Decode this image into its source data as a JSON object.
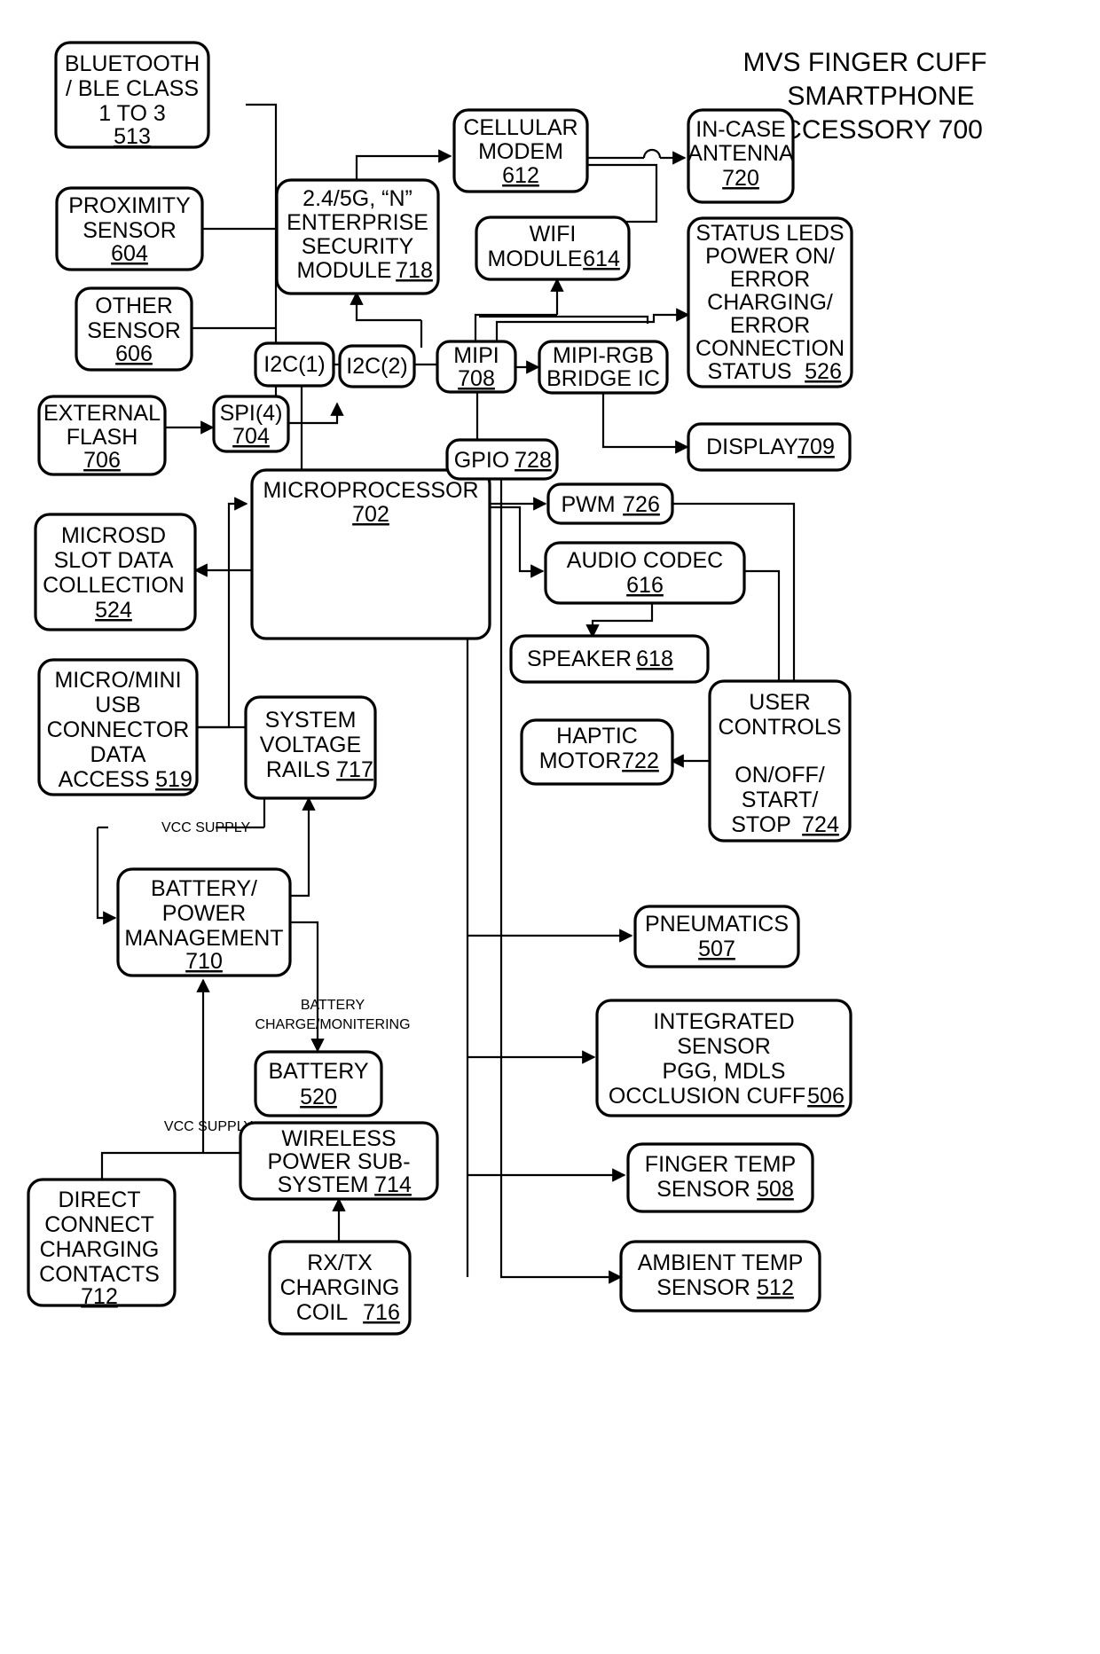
{
  "figure": {
    "title_lines": [
      "MVS FINGER CUFF",
      "SMARTPHONE",
      "ACCESSORY 700"
    ],
    "title_ref": "700"
  },
  "blocks": {
    "bluetooth": {
      "lines": [
        "BLUETOOTH",
        "/ BLE CLASS",
        "1 TO 3"
      ],
      "ref": "513"
    },
    "proximity": {
      "lines": [
        "PROXIMITY",
        "SENSOR"
      ],
      "ref": "604"
    },
    "other_sensor": {
      "lines": [
        "OTHER",
        "SENSOR"
      ],
      "ref": "606"
    },
    "external_flash": {
      "lines": [
        "EXTERNAL",
        "FLASH"
      ],
      "ref": "706"
    },
    "security": {
      "lines": [
        "2.4/5G, “N”",
        "ENTERPRISE",
        "SECURITY",
        "MODULE"
      ],
      "ref": "718",
      "ref_inline": true
    },
    "cellular": {
      "lines": [
        "CELLULAR",
        "MODEM"
      ],
      "ref": "612"
    },
    "wifi": {
      "lines": [
        "WIFI",
        "MODULE"
      ],
      "ref": "614",
      "ref_inline": true
    },
    "antenna": {
      "lines": [
        "IN-CASE",
        "ANTENNA"
      ],
      "ref": "720"
    },
    "status_leds": {
      "lines": [
        "STATUS LEDS",
        "POWER ON/",
        "ERROR",
        "CHARGING/",
        "ERROR",
        "CONNECTION",
        "STATUS"
      ],
      "ref": "526",
      "ref_inline": true
    },
    "i2c1": {
      "lines": [
        "I2C(1)"
      ],
      "ref": ""
    },
    "i2c2": {
      "lines": [
        "I2C(2)"
      ],
      "ref": ""
    },
    "mipi": {
      "lines": [
        "MIPI"
      ],
      "ref": "708"
    },
    "mipi_bridge": {
      "lines": [
        "MIPI-RGB",
        "BRIDGE IC"
      ],
      "ref": ""
    },
    "display": {
      "lines": [
        "DISPLAY"
      ],
      "ref": "709",
      "ref_inline": true
    },
    "spi": {
      "lines": [
        "SPI(4)"
      ],
      "ref": "704"
    },
    "gpio": {
      "lines": [
        "GPIO"
      ],
      "ref": "728",
      "ref_inline": true
    },
    "microprocessor": {
      "lines": [
        "MICROPROCESSOR"
      ],
      "ref": "702"
    },
    "microsd": {
      "lines": [
        "MICROSD",
        "SLOT DATA",
        "COLLECTION"
      ],
      "ref": "524"
    },
    "usb": {
      "lines": [
        "MICRO/MINI",
        "USB",
        "CONNECTOR",
        "DATA",
        "ACCESS"
      ],
      "ref": "519",
      "ref_inline": true
    },
    "voltage_rails": {
      "lines": [
        "SYSTEM",
        "VOLTAGE",
        "RAILS"
      ],
      "ref": "717",
      "ref_inline": true
    },
    "battery_mgmt": {
      "lines": [
        "BATTERY/",
        "POWER",
        "MANAGEMENT"
      ],
      "ref": "710"
    },
    "battery": {
      "lines": [
        "BATTERY"
      ],
      "ref": "520"
    },
    "wireless_power": {
      "lines": [
        "WIRELESS",
        "POWER SUB-",
        "SYSTEM"
      ],
      "ref": "714",
      "ref_inline": true
    },
    "rxtx_coil": {
      "lines": [
        "RX/TX",
        "CHARGING",
        "COIL"
      ],
      "ref": "716",
      "ref_inline": true
    },
    "direct_connect": {
      "lines": [
        "DIRECT",
        "CONNECT",
        "CHARGING",
        "CONTACTS"
      ],
      "ref": "712"
    },
    "pwm": {
      "lines": [
        "PWM"
      ],
      "ref": "726",
      "ref_inline": true
    },
    "audio_codec": {
      "lines": [
        "AUDIO CODEC"
      ],
      "ref": "616"
    },
    "speaker": {
      "lines": [
        "SPEAKER"
      ],
      "ref": "618",
      "ref_inline": true
    },
    "haptic": {
      "lines": [
        "HAPTIC",
        "MOTOR"
      ],
      "ref": "722",
      "ref_inline": true
    },
    "user_controls": {
      "lines": [
        "USER",
        "CONTROLS",
        "",
        "ON/OFF/",
        "START/",
        "STOP"
      ],
      "ref": "724",
      "ref_inline": true
    },
    "pneumatics": {
      "lines": [
        "PNEUMATICS"
      ],
      "ref": "507"
    },
    "integrated_sensor": {
      "lines": [
        "INTEGRATED",
        "SENSOR",
        "PGG, MDLS",
        "OCCLUSION CUFF"
      ],
      "ref": "506",
      "ref_inline": true
    },
    "finger_temp": {
      "lines": [
        "FINGER TEMP",
        "SENSOR"
      ],
      "ref": "508",
      "ref_inline": true
    },
    "ambient_temp": {
      "lines": [
        "AMBIENT TEMP",
        "SENSOR"
      ],
      "ref": "512",
      "ref_inline": true
    }
  },
  "wire_labels": {
    "vcc_supply_1": "VCC SUPPLY",
    "vcc_supply_2": "VCC SUPPLY",
    "battery_charge_1": "BATTERY",
    "battery_charge_2": "CHARGE/MONITERING"
  },
  "colors": {
    "stroke": "#000000",
    "background": "#ffffff"
  }
}
